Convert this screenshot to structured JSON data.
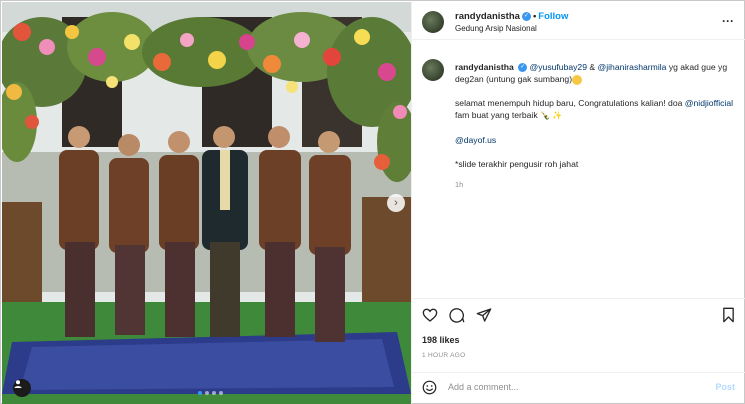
{
  "post": {
    "username": "randydanistha",
    "follow_label": "Follow",
    "separator": "•",
    "location": "Gedung Arsip Nasional",
    "more_icon": "more-horizontal-icon"
  },
  "caption": {
    "username": "randydanistha",
    "mention_1": "@yusufubay29",
    "amp": "&",
    "mention_2": "@jihanirasharmila",
    "line_1_rest": "yg akad gue yg deg2an (untung gak sumbang)",
    "line_2_text": "selamat menempuh hidup baru, Congratulations kalian! doa",
    "mention_3": "@nidjiofficial",
    "line_2_rest": "fam buat yang terbaik",
    "mention_4": "@dayof.us",
    "line_4": "*slide terakhir pengusir roh jahat",
    "time": "1h"
  },
  "actions": {
    "likes": "198 likes",
    "time_ago": "1 HOUR AGO",
    "icons": [
      "heart-icon",
      "comment-icon",
      "share-icon",
      "bookmark-icon"
    ]
  },
  "comment": {
    "placeholder": "Add a comment...",
    "post_label": "Post"
  },
  "carousel": {
    "slides": 4,
    "active_index": 0
  },
  "colors": {
    "accent": "#0095f6",
    "verified": "#3897f0",
    "mention": "#00376b",
    "post_disabled": "#b3dbff"
  }
}
